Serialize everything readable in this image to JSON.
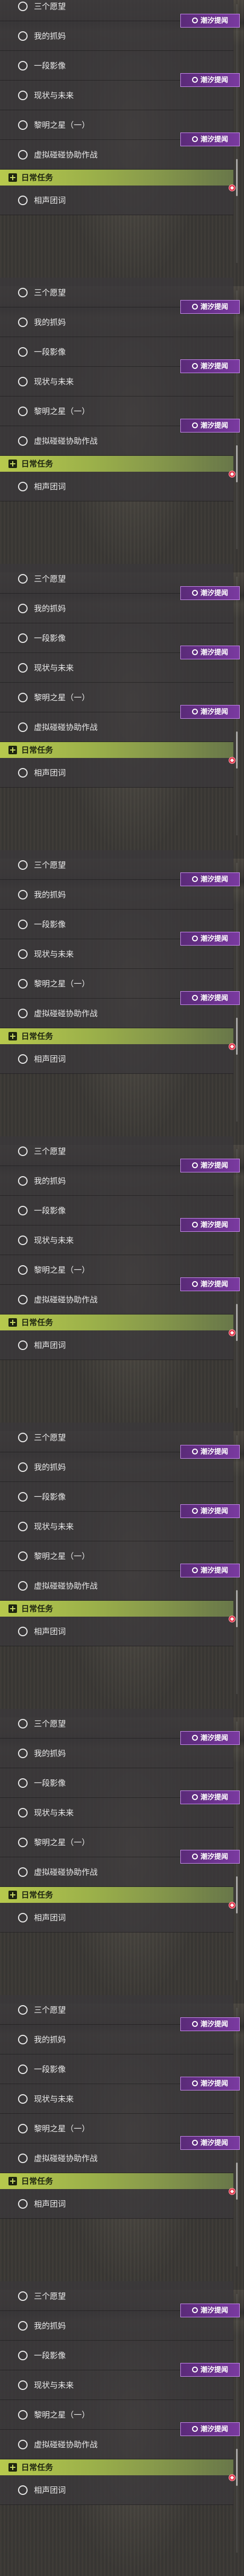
{
  "panels_count": 9,
  "quest_list": {
    "items": [
      {
        "label": "三个愿望"
      },
      {
        "label": "我的抓妈"
      },
      {
        "label": "一段影像"
      },
      {
        "label": "现状与未来"
      },
      {
        "label": "黎明之星（一）"
      },
      {
        "label": "虚拟碰碰协助作战"
      }
    ],
    "badge": {
      "text": "潮汐提闻",
      "icon": "event-tag-icon"
    },
    "daily_section": {
      "title": "日常任务",
      "icon": "quest-category-icon"
    },
    "daily_items": [
      {
        "label": "相声团词"
      }
    ]
  },
  "colors": {
    "row_bg": "#3a383a",
    "section_green": "#b7c94d",
    "badge_purple": "#6a3290",
    "alert_red": "#e23a4e"
  }
}
